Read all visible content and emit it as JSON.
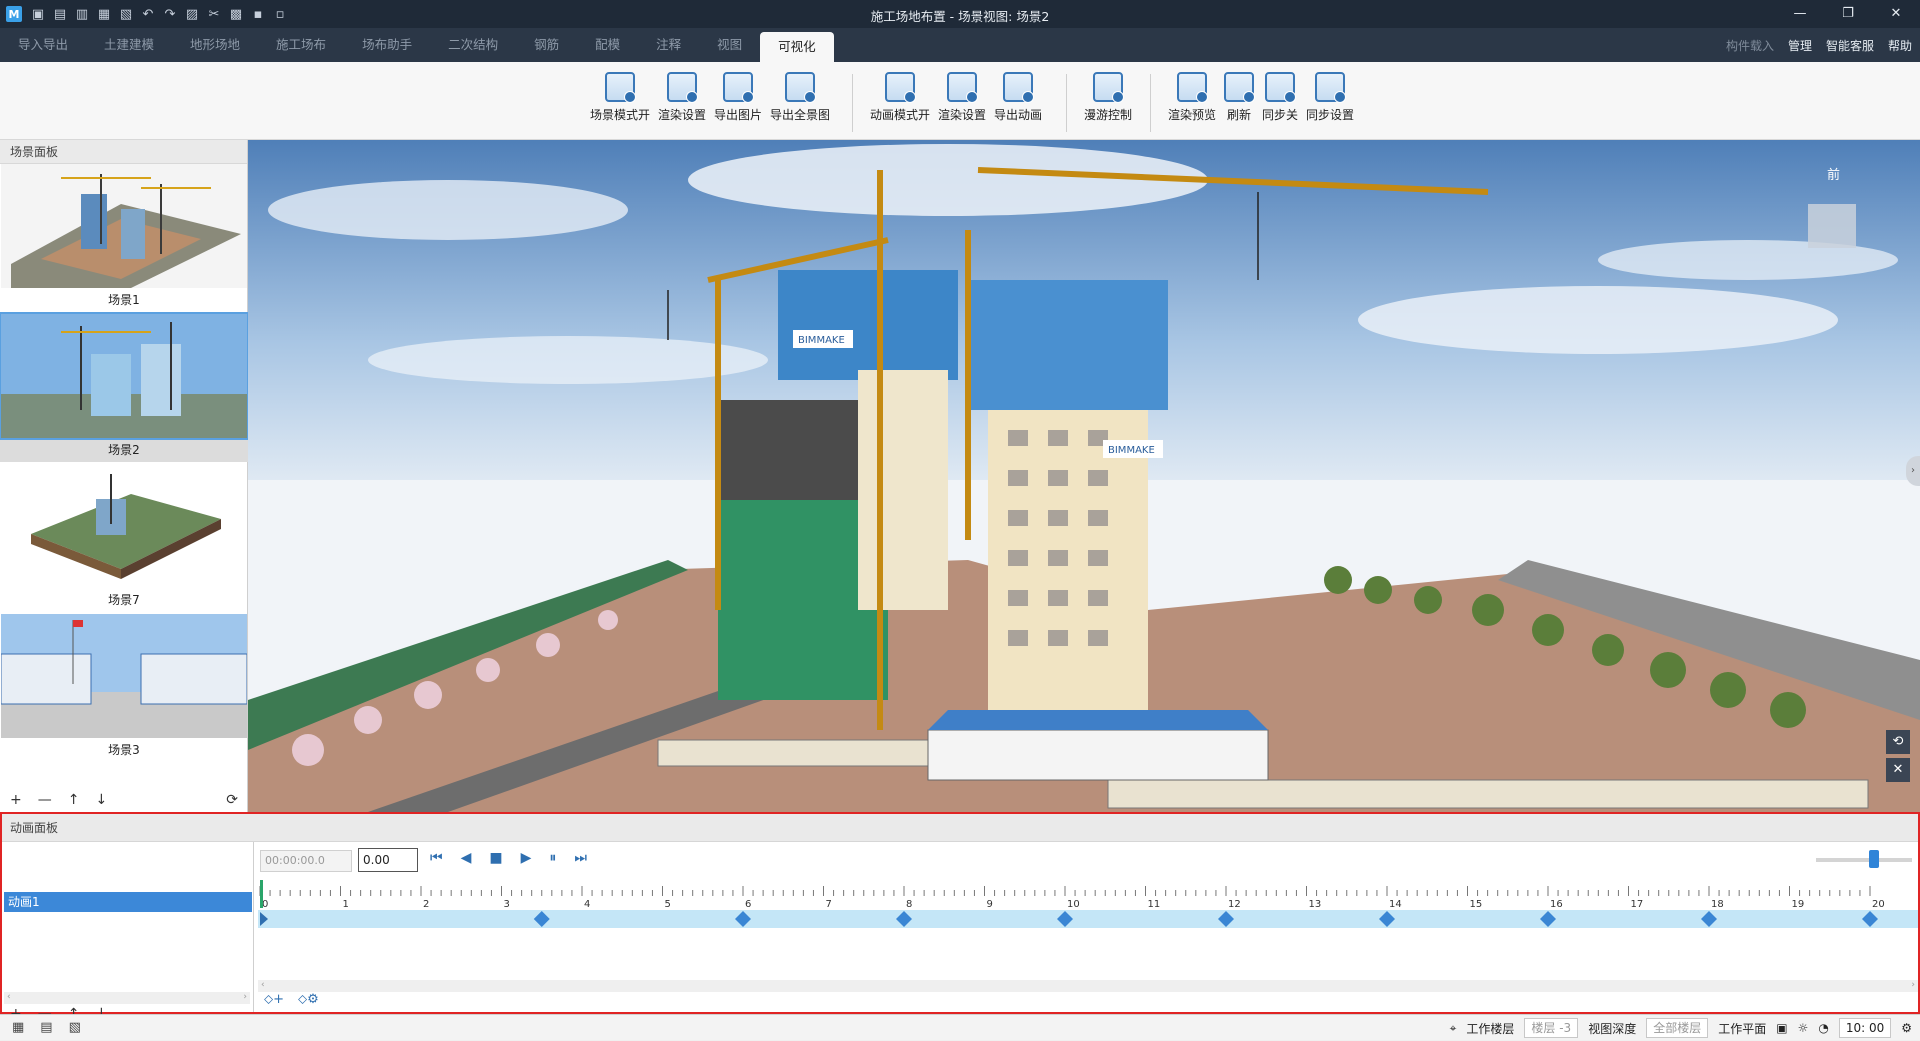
{
  "window": {
    "title": "施工场地布置 - 场景视图: 场景2",
    "min": "—",
    "max": "❐",
    "close": "✕"
  },
  "quick_access": [
    "▣",
    "▤",
    "▥",
    "▦",
    "▧",
    "↶",
    "↷",
    "▨",
    "✂",
    "▩",
    "▪",
    "▫"
  ],
  "tabs": [
    {
      "label": "导入导出",
      "active": false
    },
    {
      "label": "土建建模",
      "active": false
    },
    {
      "label": "地形场地",
      "active": false
    },
    {
      "label": "施工场布",
      "active": false
    },
    {
      "label": "场布助手",
      "active": false
    },
    {
      "label": "二次结构",
      "active": false
    },
    {
      "label": "钢筋",
      "active": false
    },
    {
      "label": "配模",
      "active": false
    },
    {
      "label": "注释",
      "active": false
    },
    {
      "label": "视图",
      "active": false
    },
    {
      "label": "可视化",
      "active": true
    }
  ],
  "tab_right": {
    "component_load": "构件载入",
    "manage": "管理",
    "support": "智能客服",
    "help": "帮助"
  },
  "ribbon": {
    "group1": [
      "场景模式开",
      "渲染设置",
      "导出图片",
      "导出全景图"
    ],
    "group2": [
      "动画模式开",
      "渲染设置",
      "导出动画"
    ],
    "group3": [
      "漫游控制"
    ],
    "group4": [
      "渲染预览",
      "刷新",
      "同步关",
      "同步设置"
    ]
  },
  "scene_panel": {
    "title": "场景面板",
    "scenes": [
      {
        "label": "场景1",
        "selected": false
      },
      {
        "label": "场景2",
        "selected": true
      },
      {
        "label": "场景7",
        "selected": false
      },
      {
        "label": "场景3",
        "selected": false
      }
    ],
    "tools": [
      "+",
      "—",
      "↑",
      "↓"
    ],
    "refresh": "⟳"
  },
  "viewport": {
    "view_label": "前",
    "banner_text": "BIMMAKE"
  },
  "anim_panel": {
    "title": "动画面板",
    "track": "动画1",
    "timecode": "00:00:00.0",
    "time_value": "0.00",
    "controls": [
      "⏮",
      "◀",
      "■",
      "▶",
      "⏸",
      "⏭"
    ],
    "ruler_ticks": [
      "0",
      "1",
      "2",
      "3",
      "4",
      "5",
      "6",
      "7",
      "8",
      "9",
      "10",
      "11",
      "12",
      "13",
      "14",
      "15",
      "16",
      "17",
      "18",
      "19",
      "20"
    ],
    "keyframe_seconds": [
      3.5,
      6,
      8,
      10,
      12,
      14,
      16,
      18,
      20
    ],
    "zoom_level": 0.6,
    "left_tools": [
      "+",
      "—",
      "↑",
      "↓"
    ],
    "right_tools": [
      "⬦+",
      "⬦⚙"
    ]
  },
  "statusbar": {
    "work_floor_label": "工作楼层",
    "work_floor_value": "楼层 -3",
    "view_depth_label": "视图深度",
    "view_depth_value": "全部楼层",
    "work_plane_label": "工作平面",
    "time": "10: 00"
  }
}
